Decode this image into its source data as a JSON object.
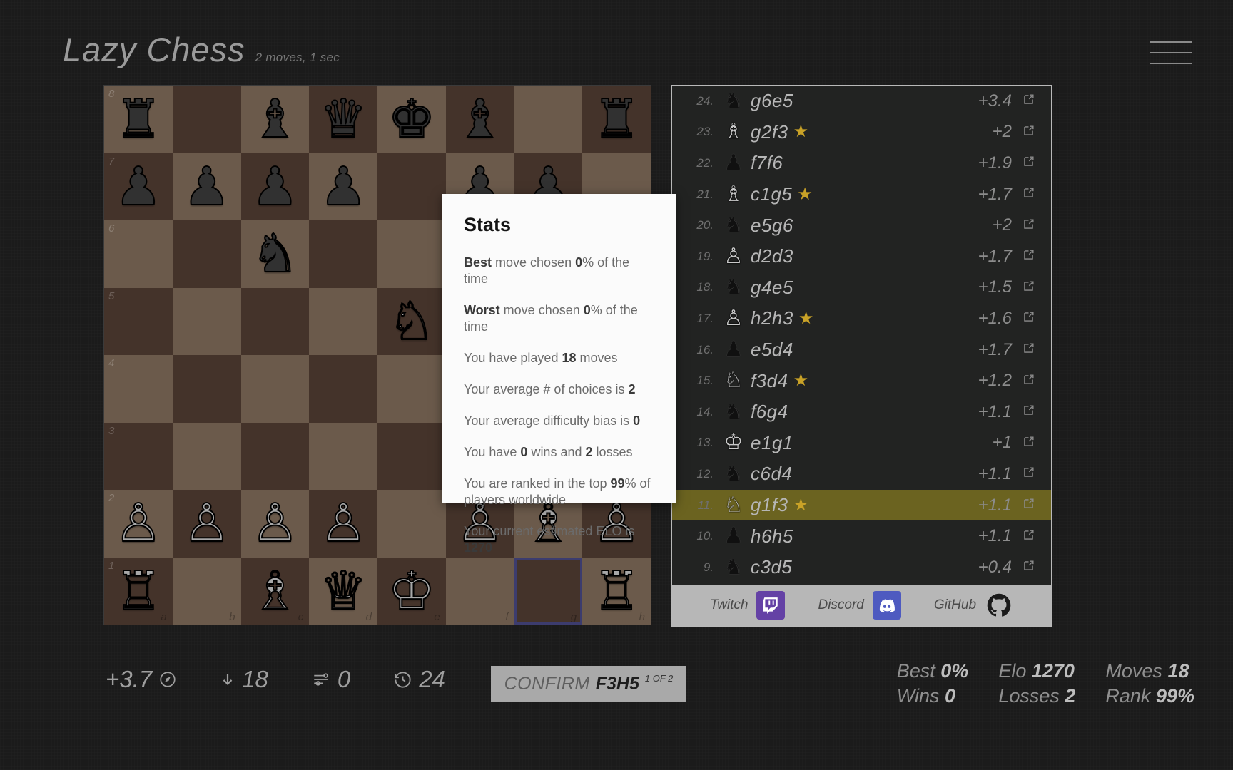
{
  "header": {
    "title": "Lazy Chess",
    "subtitle": "2 moves, 1 sec",
    "menu_icon": "hamburger-menu-icon"
  },
  "board": {
    "files": [
      "a",
      "b",
      "c",
      "d",
      "e",
      "f",
      "g",
      "h"
    ],
    "ranks": [
      "8",
      "7",
      "6",
      "5",
      "4",
      "3",
      "2",
      "1"
    ],
    "selected_square": "g1",
    "light_color": "#6b5a4b",
    "dark_color": "#44332a",
    "rows": [
      [
        {
          "p": "r",
          "c": "b"
        },
        {
          "p": "",
          "c": ""
        },
        {
          "p": "b",
          "c": "b"
        },
        {
          "p": "q",
          "c": "b"
        },
        {
          "p": "k",
          "c": "b"
        },
        {
          "p": "b",
          "c": "b"
        },
        {
          "p": "",
          "c": ""
        },
        {
          "p": "r",
          "c": "b"
        }
      ],
      [
        {
          "p": "p",
          "c": "b"
        },
        {
          "p": "p",
          "c": "b"
        },
        {
          "p": "p",
          "c": "b"
        },
        {
          "p": "p",
          "c": "b"
        },
        {
          "p": "",
          "c": ""
        },
        {
          "p": "p",
          "c": "b"
        },
        {
          "p": "p",
          "c": "b"
        },
        {
          "p": "",
          "c": ""
        }
      ],
      [
        {
          "p": "",
          "c": ""
        },
        {
          "p": "",
          "c": ""
        },
        {
          "p": "n",
          "c": "b"
        },
        {
          "p": "",
          "c": ""
        },
        {
          "p": "",
          "c": ""
        },
        {
          "p": "",
          "c": ""
        },
        {
          "p": "",
          "c": ""
        },
        {
          "p": "",
          "c": ""
        }
      ],
      [
        {
          "p": "",
          "c": ""
        },
        {
          "p": "",
          "c": ""
        },
        {
          "p": "",
          "c": ""
        },
        {
          "p": "",
          "c": ""
        },
        {
          "p": "n",
          "c": "w"
        },
        {
          "p": "p",
          "c": "b"
        },
        {
          "p": "",
          "c": ""
        },
        {
          "p": "",
          "c": ""
        }
      ],
      [
        {
          "p": "",
          "c": ""
        },
        {
          "p": "",
          "c": ""
        },
        {
          "p": "",
          "c": ""
        },
        {
          "p": "",
          "c": ""
        },
        {
          "p": "",
          "c": ""
        },
        {
          "p": "p",
          "c": "w"
        },
        {
          "p": "",
          "c": ""
        },
        {
          "p": "",
          "c": ""
        }
      ],
      [
        {
          "p": "",
          "c": ""
        },
        {
          "p": "",
          "c": ""
        },
        {
          "p": "",
          "c": ""
        },
        {
          "p": "",
          "c": ""
        },
        {
          "p": "",
          "c": ""
        },
        {
          "p": "",
          "c": ""
        },
        {
          "p": "",
          "c": ""
        },
        {
          "p": "",
          "c": ""
        }
      ],
      [
        {
          "p": "p",
          "c": "w"
        },
        {
          "p": "p",
          "c": "w"
        },
        {
          "p": "p",
          "c": "w"
        },
        {
          "p": "p",
          "c": "w"
        },
        {
          "p": "",
          "c": ""
        },
        {
          "p": "p",
          "c": "w"
        },
        {
          "p": "b",
          "c": "w"
        },
        {
          "p": "p",
          "c": "w"
        }
      ],
      [
        {
          "p": "r",
          "c": "w"
        },
        {
          "p": "",
          "c": ""
        },
        {
          "p": "b",
          "c": "w"
        },
        {
          "p": "q",
          "c": "w"
        },
        {
          "p": "k",
          "c": "w"
        },
        {
          "p": "",
          "c": ""
        },
        {
          "p": "",
          "c": ""
        },
        {
          "p": "r",
          "c": "w"
        }
      ]
    ]
  },
  "movelist": {
    "active_number": "11",
    "rows": [
      {
        "num": "24.",
        "piece": "n",
        "color": "b",
        "move": "g6e5",
        "star": false,
        "score": "+3.4",
        "link_icon": "external-link-icon"
      },
      {
        "num": "23.",
        "piece": "b",
        "color": "w",
        "move": "g2f3",
        "star": true,
        "score": "+2",
        "link_icon": "external-link-icon"
      },
      {
        "num": "22.",
        "piece": "p",
        "color": "b",
        "move": "f7f6",
        "star": false,
        "score": "+1.9",
        "link_icon": "external-link-icon"
      },
      {
        "num": "21.",
        "piece": "b",
        "color": "w",
        "move": "c1g5",
        "star": true,
        "score": "+1.7",
        "link_icon": "external-link-icon"
      },
      {
        "num": "20.",
        "piece": "n",
        "color": "b",
        "move": "e5g6",
        "star": false,
        "score": "+2",
        "link_icon": "external-link-icon"
      },
      {
        "num": "19.",
        "piece": "p",
        "color": "w",
        "move": "d2d3",
        "star": false,
        "score": "+1.7",
        "link_icon": "external-link-icon"
      },
      {
        "num": "18.",
        "piece": "n",
        "color": "b",
        "move": "g4e5",
        "star": false,
        "score": "+1.5",
        "link_icon": "external-link-icon"
      },
      {
        "num": "17.",
        "piece": "p",
        "color": "w",
        "move": "h2h3",
        "star": true,
        "score": "+1.6",
        "link_icon": "external-link-icon"
      },
      {
        "num": "16.",
        "piece": "p",
        "color": "b",
        "move": "e5d4",
        "star": false,
        "score": "+1.7",
        "link_icon": "external-link-icon"
      },
      {
        "num": "15.",
        "piece": "n",
        "color": "w",
        "move": "f3d4",
        "star": true,
        "score": "+1.2",
        "link_icon": "external-link-icon"
      },
      {
        "num": "14.",
        "piece": "n",
        "color": "b",
        "move": "f6g4",
        "star": false,
        "score": "+1.1",
        "link_icon": "external-link-icon"
      },
      {
        "num": "13.",
        "piece": "k",
        "color": "w",
        "move": "e1g1",
        "star": false,
        "score": "+1",
        "link_icon": "external-link-icon"
      },
      {
        "num": "12.",
        "piece": "n",
        "color": "b",
        "move": "c6d4",
        "star": false,
        "score": "+1.1",
        "link_icon": "external-link-icon"
      },
      {
        "num": "11.",
        "piece": "n",
        "color": "w",
        "move": "g1f3",
        "star": true,
        "score": "+1.1",
        "link_icon": "external-link-icon"
      },
      {
        "num": "10.",
        "piece": "p",
        "color": "b",
        "move": "h6h5",
        "star": false,
        "score": "+1.1",
        "link_icon": "external-link-icon"
      },
      {
        "num": "9.",
        "piece": "n",
        "color": "b",
        "move": "c3d5",
        "star": false,
        "score": "+0.4",
        "link_icon": "external-link-icon"
      }
    ]
  },
  "social": {
    "items": [
      {
        "label": "Twitch",
        "icon": "twitch-icon",
        "color": "#6441a5"
      },
      {
        "label": "Discord",
        "icon": "discord-icon",
        "color": "#4e5ac0"
      },
      {
        "label": "GitHub",
        "icon": "github-icon",
        "color": "#1b1b1b"
      }
    ]
  },
  "toolbar": {
    "eval": "+3.7",
    "eval_icon": "compass-icon",
    "depth": "18",
    "depth_icon": "arrow-down-icon",
    "bias": "0",
    "bias_icon": "sliders-icon",
    "time": "24",
    "time_icon": "history-clock-icon"
  },
  "confirm": {
    "label": "CONFIRM",
    "move": "F3H5",
    "count": "1 OF 2"
  },
  "summary": {
    "cells": [
      {
        "label": "Best",
        "value": "0%"
      },
      {
        "label": "Elo",
        "value": "1270"
      },
      {
        "label": "Moves",
        "value": "18"
      },
      {
        "label": "Wins",
        "value": "0"
      },
      {
        "label": "Losses",
        "value": "2"
      },
      {
        "label": "Rank",
        "value": "99%"
      }
    ]
  },
  "stats_dialog": {
    "title": "Stats",
    "lines": [
      {
        "pre": "",
        "b1": "Best",
        "mid": " move chosen ",
        "b2": "0",
        "post": "% of the time"
      },
      {
        "pre": "",
        "b1": "Worst",
        "mid": " move chosen ",
        "b2": "0",
        "post": "% of the time"
      },
      {
        "pre": "You have played ",
        "b1": "",
        "mid": "",
        "b2": "18",
        "post": " moves"
      },
      {
        "pre": "Your average # of choices is ",
        "b1": "",
        "mid": "",
        "b2": "2",
        "post": ""
      },
      {
        "pre": "Your average difficulty bias is ",
        "b1": "",
        "mid": "",
        "b2": "0",
        "post": ""
      },
      {
        "pre": "You have ",
        "b1": "",
        "mid": "",
        "b2": "0",
        "post": " wins and ",
        "b3": "2",
        "post2": " losses"
      },
      {
        "pre": "You are ranked in the top ",
        "b1": "",
        "mid": "",
        "b2": "99",
        "post": "% of players worldwide"
      },
      {
        "pre": "Your current estimated ELO is ",
        "b1": "",
        "mid": "",
        "b2": "1270",
        "post": ""
      }
    ]
  }
}
